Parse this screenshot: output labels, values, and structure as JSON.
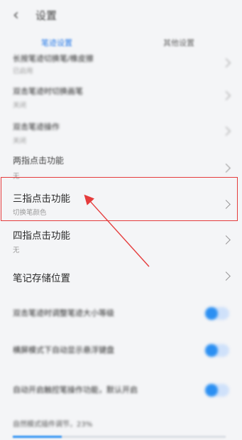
{
  "header": {
    "back_glyph": "‹",
    "title": "设置"
  },
  "tabs": [
    {
      "label": "笔迹设置"
    },
    {
      "label": "其他设置"
    }
  ],
  "settings": [
    {
      "label": "长按笔迹切换笔/橡皮擦",
      "sub": "已启用"
    },
    {
      "label": "双击笔迹时切换画笔",
      "sub": "关闭"
    },
    {
      "label": "双击笔迹操作",
      "sub": "关闭"
    },
    {
      "label": "两指点击功能",
      "sub": "无"
    },
    {
      "label": "三指点击功能",
      "sub": "切换笔颜色"
    },
    {
      "label": "四指点击功能",
      "sub": "无"
    },
    {
      "label": "笔记存储位置",
      "sub": ""
    }
  ],
  "toggles": [
    {
      "label": "双击笔迹时调整笔迹大小等级",
      "on": true
    },
    {
      "label": "横屏模式下自动显示悬浮键盘",
      "on": true
    },
    {
      "label": "自动开启触控笔操作功能，默认开启",
      "on": true
    }
  ],
  "slider": {
    "label": "自然模式插件调节，23%",
    "value": 0.23
  },
  "annotation": {
    "highlight_color": "#e53c3c"
  }
}
